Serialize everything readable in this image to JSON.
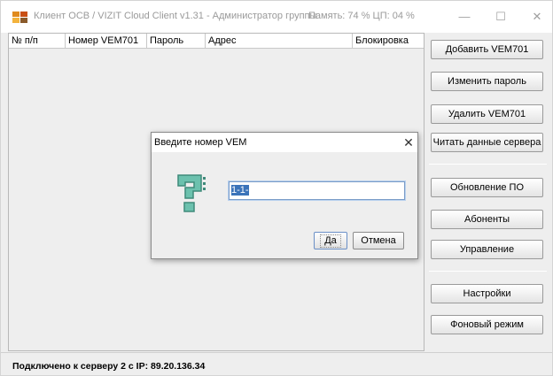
{
  "window": {
    "title": "Клиент ОСВ / VIZIT Cloud Client v1.31 - Администратор группы",
    "status_memory_cpu": "Память: 74 % ЦП: 04 %"
  },
  "table": {
    "columns": [
      "№ п/п",
      "Номер VEM701",
      "Пароль",
      "Адрес",
      "Блокировка"
    ],
    "rows": []
  },
  "sidebar": {
    "add_label": "Добавить VEM701",
    "change_password_label": "Изменить пароль",
    "delete_label": "Удалить VEM701",
    "read_server_label": "Читать данные сервера",
    "update_label": "Обновление ПО",
    "subscribers_label": "Абоненты",
    "control_label": "Управление",
    "settings_label": "Настройки",
    "background_label": "Фоновый режим"
  },
  "statusbar": {
    "text": "Подключено к серверу 2 с IP:  89.20.136.34"
  },
  "dialog": {
    "title": "Введите номер VEM",
    "input_value": "1-1-",
    "yes_label": "Да",
    "cancel_label": "Отмена",
    "icon": "question-icon"
  },
  "colors": {
    "accent": "#3b73b9",
    "icon_teal": "#5fb3a3"
  }
}
